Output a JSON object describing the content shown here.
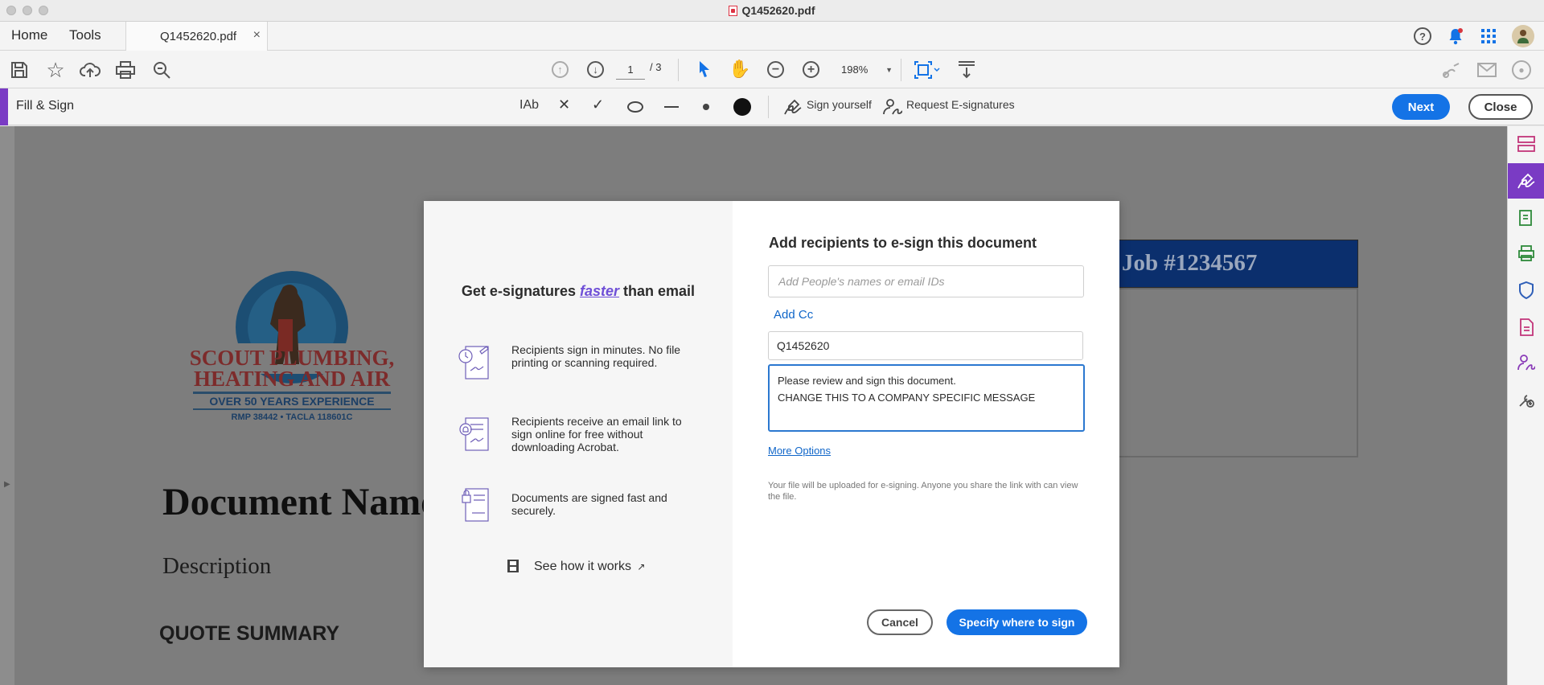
{
  "window": {
    "title": "Q1452620.pdf"
  },
  "tabs": {
    "home": "Home",
    "tools": "Tools",
    "document": "Q1452620.pdf",
    "close_glyph": "×"
  },
  "toolbar": {
    "page_current": "1",
    "page_total": "/ 3",
    "zoom": "198%"
  },
  "fill_sign": {
    "title": "Fill & Sign",
    "text_tool": "IAb",
    "sign_yourself": "Sign yourself",
    "request": "Request E-signatures",
    "next": "Next",
    "close": "Close"
  },
  "document": {
    "logo": {
      "line1": "SCOUT PLUMBING,",
      "line2": "HEATING AND AIR",
      "line3": "OVER 50 YEARS EXPERIENCE",
      "line4": "RMP 38442 • TACLA 118601C"
    },
    "heading": "Document Name",
    "description": "Description",
    "quote_summary": "QUOTE SUMMARY",
    "job": "Job #1234567"
  },
  "modal": {
    "left_title_pre": "Get e-signatures",
    "left_title_em": "faster",
    "left_title_post": "than email",
    "features": [
      {
        "text": "Recipients sign in minutes. No file printing or scanning required."
      },
      {
        "text": "Recipients receive an email link to sign online for free without downloading Acrobat."
      },
      {
        "text": "Documents are signed fast and securely."
      }
    ],
    "see_how": "See how it works",
    "right_title": "Add recipients to e-sign this document",
    "recipients_placeholder": "Add People's names or email IDs",
    "add_cc": "Add Cc",
    "subject": "Q1452620",
    "message_line1": "Please review and sign this document.",
    "message_line2": "CHANGE THIS TO A COMPANY SPECIFIC MESSAGE",
    "more_options": "More Options",
    "note": "Your file will be uploaded for e-signing. Anyone you share the link with can view the file.",
    "cancel": "Cancel",
    "specify": "Specify where to sign"
  },
  "colors": {
    "accent": "#1473e6",
    "purple": "#7a3bc4",
    "bell": "#1473e6"
  }
}
